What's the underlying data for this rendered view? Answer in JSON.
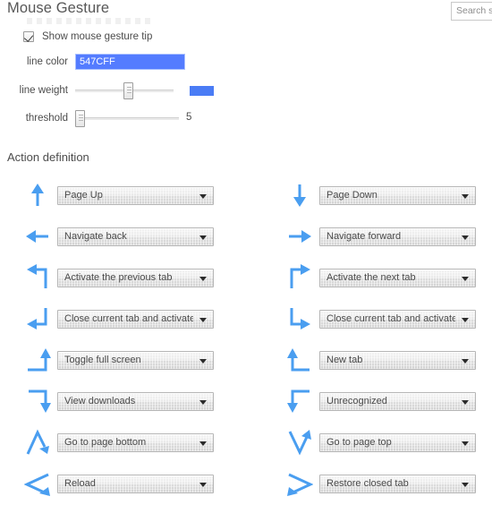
{
  "header": {
    "title": "Mouse Gesture",
    "search_placeholder": "Search se"
  },
  "settings": {
    "show_tip_label": "Show mouse gesture tip",
    "show_tip_checked": true,
    "line_color_label": "line color",
    "line_color_value": "547CFF",
    "line_weight_label": "line weight",
    "threshold_label": "threshold",
    "threshold_value": "5",
    "accent_color": "#547CFF",
    "arrow_color": "#4a9ef0"
  },
  "actions": {
    "section_title": "Action definition",
    "rows": [
      {
        "left_icon": "arrow-up-icon",
        "left_label": "Page Up",
        "right_icon": "arrow-down-icon",
        "right_label": "Page Down"
      },
      {
        "left_icon": "arrow-left-icon",
        "left_label": "Navigate back",
        "right_icon": "arrow-right-icon",
        "right_label": "Navigate forward"
      },
      {
        "left_icon": "up-then-left-icon",
        "left_label": "Activate the previous tab",
        "right_icon": "up-then-right-icon",
        "right_label": "Activate the next tab"
      },
      {
        "left_icon": "down-then-left-icon",
        "left_label": "Close current tab and activate t",
        "right_icon": "down-then-right-icon",
        "right_label": "Close current tab and activate t"
      },
      {
        "left_icon": "right-then-up-icon",
        "left_label": "Toggle full screen",
        "right_icon": "left-then-up-icon",
        "right_label": "New tab"
      },
      {
        "left_icon": "right-then-down-icon",
        "left_label": "View downloads",
        "right_icon": "left-then-down-icon",
        "right_label": "Unrecognized"
      },
      {
        "left_icon": "up-then-down-icon",
        "left_label": "Go to page bottom",
        "right_icon": "down-then-up-icon",
        "right_label": "Go to page top"
      },
      {
        "left_icon": "left-zigzag-icon",
        "left_label": "Reload",
        "right_icon": "right-zigzag-icon",
        "right_label": "Restore closed tab"
      }
    ]
  }
}
